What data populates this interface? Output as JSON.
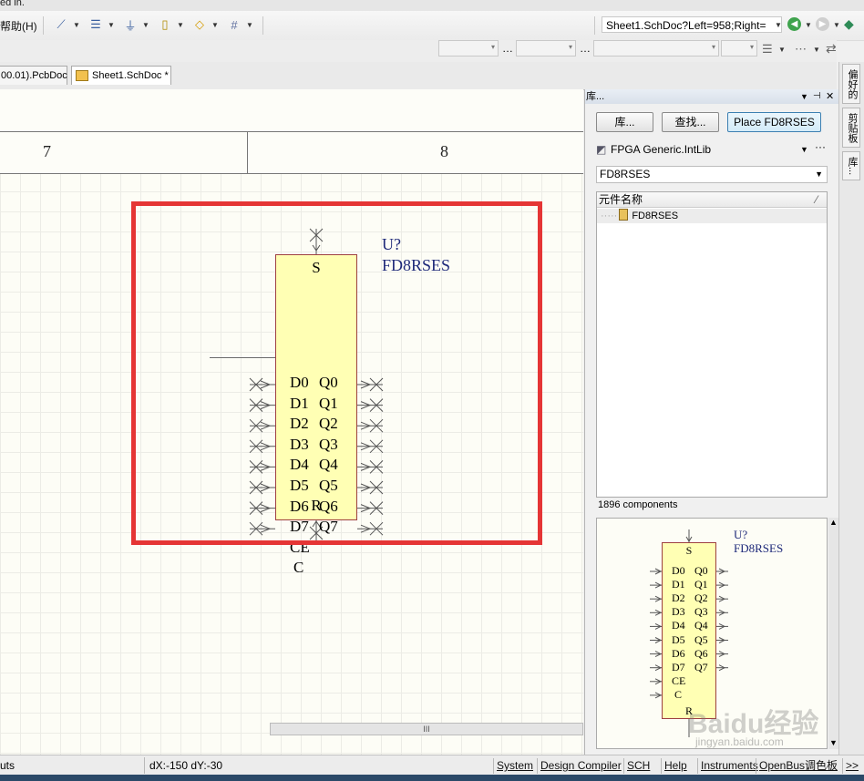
{
  "top_fragment": "ed in.",
  "menu": {
    "help": "帮助(H)"
  },
  "address": {
    "value": "Sheet1.SchDoc?Left=958;Right="
  },
  "tabs": [
    {
      "label": "00.01).PcbDoc"
    },
    {
      "label": "Sheet1.SchDoc *"
    }
  ],
  "zones": [
    "7",
    "8"
  ],
  "component": {
    "designator": "U?",
    "name": "FD8RSES",
    "top_pin": "S",
    "bottom_pin": "R",
    "left_pins": [
      "D0",
      "D1",
      "D2",
      "D3",
      "D4",
      "D5",
      "D6",
      "D7",
      "CE",
      "C"
    ],
    "right_pins": [
      "Q0",
      "Q1",
      "Q2",
      "Q3",
      "Q4",
      "Q5",
      "Q6",
      "Q7"
    ]
  },
  "library_panel": {
    "title": "库...",
    "buttons": {
      "libraries": "库...",
      "search": "查找...",
      "place": "Place FD8RSES"
    },
    "library_name": "FPGA Generic.IntLib",
    "filter": "FD8RSES",
    "column_header": "元件名称",
    "items": [
      "FD8RSES"
    ],
    "count": "1896 components"
  },
  "side_tabs": [
    "偏好的",
    "剪贴板",
    "库..."
  ],
  "status": {
    "left_fragment": "uts",
    "delta": "dX:-150 dY:-30",
    "buttons": [
      "System",
      "Design Compiler",
      "SCH",
      "Help",
      "Instruments",
      "OpenBus调色板",
      ">>"
    ]
  },
  "colors": {
    "highlight_box": "#e53535",
    "component_fill": "#ffffb4",
    "component_border": "#9e4040",
    "designator_text": "#1f2a7a"
  },
  "watermark": {
    "brand": "Baidu经验",
    "url": "jingyan.baidu.com"
  }
}
